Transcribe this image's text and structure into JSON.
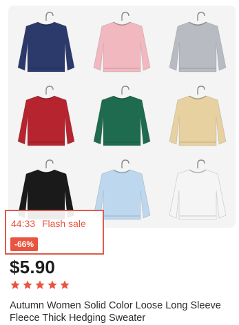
{
  "flash": {
    "timer": "44:33",
    "label": "Flash sale",
    "discount": "-66%"
  },
  "product": {
    "price": "$5.90",
    "rating": 5,
    "rating_max": 5,
    "title": "Autumn Women Solid Color Loose Long Sleeve Fleece Thick Hedging Sweater",
    "sweater_colors": [
      "#2b3a6b",
      "#f2b8bf",
      "#b8bbc2",
      "#b5242f",
      "#1f6b4f",
      "#e8d1a0",
      "#1a1a1a",
      "#bcd7ee",
      "#f5f5f5"
    ]
  },
  "colors": {
    "accent": "#e8553f",
    "star": "#e8553f"
  }
}
